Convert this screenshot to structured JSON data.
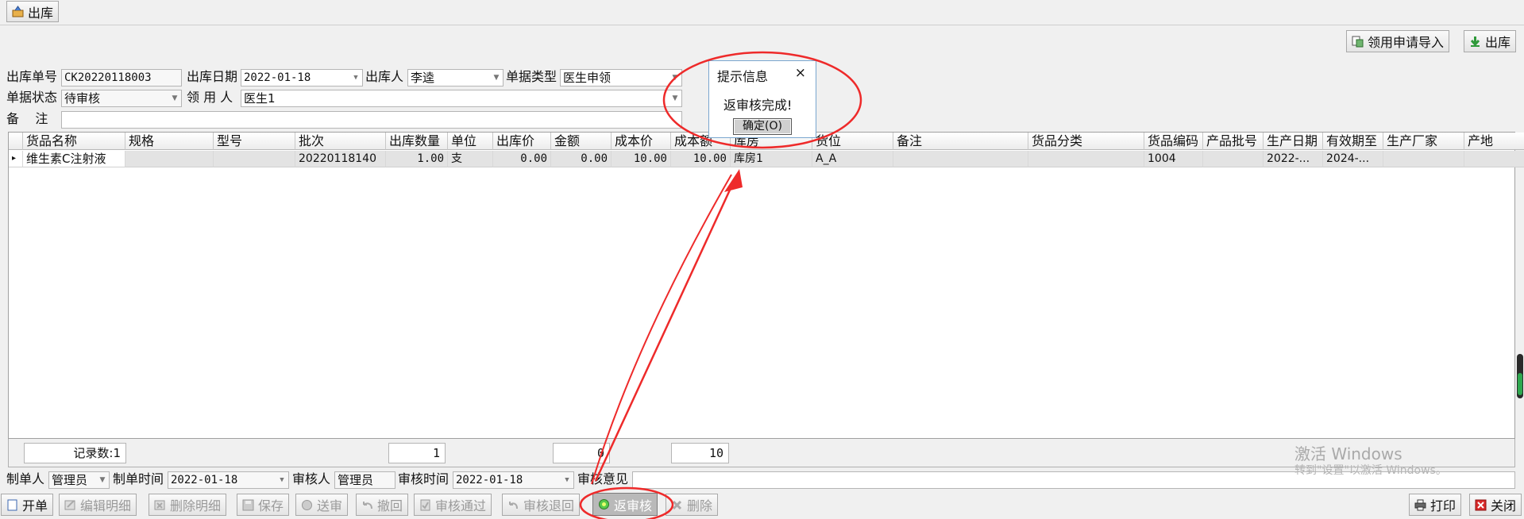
{
  "top_toolbar": {
    "stock_out_label": "出库"
  },
  "action_bar": {
    "import_label": "领用申请导入",
    "stock_out_label": "出库"
  },
  "form": {
    "order_no_label": "出库单号",
    "order_no": "CK20220118003",
    "out_date_label": "出库日期",
    "out_date": "2022-01-18",
    "operator_label": "出库人",
    "operator": "李逵",
    "doc_type_label": "单据类型",
    "doc_type": "医生申领",
    "status_label": "单据状态",
    "status": "待审核",
    "recipient_label": "领 用 人",
    "recipient": "医生1",
    "remark_label": "备    注",
    "remark": ""
  },
  "grid": {
    "columns": [
      "货品名称",
      "规格",
      "型号",
      "批次",
      "出库数量",
      "单位",
      "出库价",
      "金额",
      "成本价",
      "成本额",
      "库房",
      "货位",
      "备注",
      "货品分类",
      "货品编码",
      "产品批号",
      "生产日期",
      "有效期至",
      "生产厂家",
      "产地"
    ],
    "row": [
      "维生素C注射液",
      "",
      "",
      "20220118140",
      "1.00",
      "支",
      "0.00",
      "0.00",
      "10.00",
      "10.00",
      "库房1",
      "A_A",
      "",
      "",
      "1004",
      "",
      "2022-...",
      "2024-...",
      "",
      ""
    ],
    "row_marker": "▸"
  },
  "summary": {
    "records": "记录数:1",
    "qty_total": "1",
    "amount_total": "0",
    "cost_total": "10"
  },
  "footer": {
    "maker_label": "制单人",
    "maker": "管理员",
    "make_time_label": "制单时间",
    "make_time": "2022-01-18",
    "auditor_label": "审核人",
    "auditor": "管理员",
    "audit_time_label": "审核时间",
    "audit_time": "2022-01-18",
    "audit_opinion_label": "审核意见",
    "audit_opinion": ""
  },
  "bottom_toolbar": {
    "new_label": "开单",
    "edit_label": "编辑明细",
    "delete_detail_label": "删除明细",
    "save_label": "保存",
    "submit_label": "送审",
    "recall_label": "撤回",
    "approve_label": "审核通过",
    "reject_label": "审核退回",
    "unaudit_label": "返审核",
    "delete_label": "删除",
    "print_label": "打印",
    "close_label": "关闭"
  },
  "dialog": {
    "title": "提示信息",
    "close_glyph": "×",
    "message": "返审核完成!",
    "ok_label": "确定(O)"
  },
  "watermark": {
    "line1": "激活 Windows",
    "line2": "转到\"设置\"以激活 Windows。"
  },
  "colors": {
    "annotation_red": "#ee2a2a",
    "dialog_border": "#7aa6cf",
    "selected_row": "#e3e3e3"
  }
}
